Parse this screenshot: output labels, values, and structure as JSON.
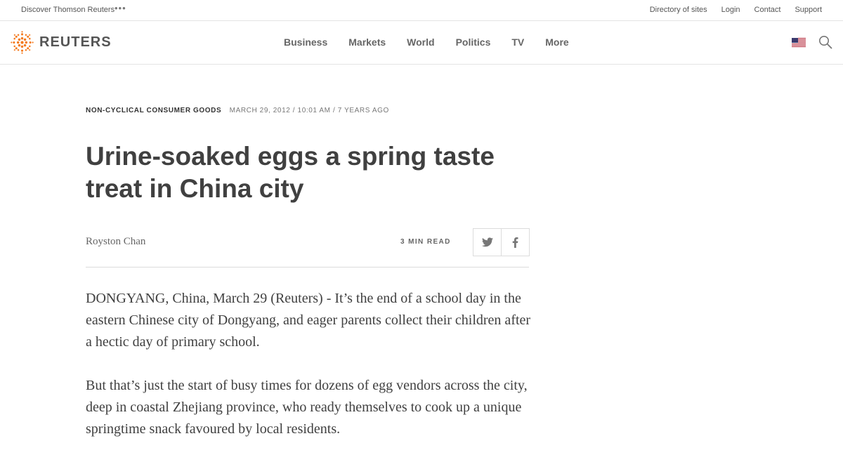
{
  "topbar": {
    "discover": "Discover Thomson Reuters",
    "links": [
      "Directory of sites",
      "Login",
      "Contact",
      "Support"
    ]
  },
  "header": {
    "logo_text": "REUTERS",
    "nav": [
      "Business",
      "Markets",
      "World",
      "Politics",
      "TV",
      "More"
    ]
  },
  "article": {
    "section": "Non-Cyclical Consumer Goods",
    "meta": "March 29, 2012 / 10:01 AM / 7 years ago",
    "headline": "Urine-soaked eggs a spring taste treat in China city",
    "author": "Royston Chan",
    "read_time": "3 MIN READ",
    "paragraphs": [
      "DONGYANG, China, March 29 (Reuters) - It’s the end of a school day in the eastern Chinese city of Dongyang, and eager parents collect their children after a hectic day of primary school.",
      "But that’s just the start of busy times for dozens of egg vendors across the city, deep in coastal Zhejiang province, who ready themselves to cook up a unique springtime snack favoured by local residents."
    ]
  },
  "colors": {
    "brand_orange": "#f47b20",
    "text": "#404040"
  }
}
